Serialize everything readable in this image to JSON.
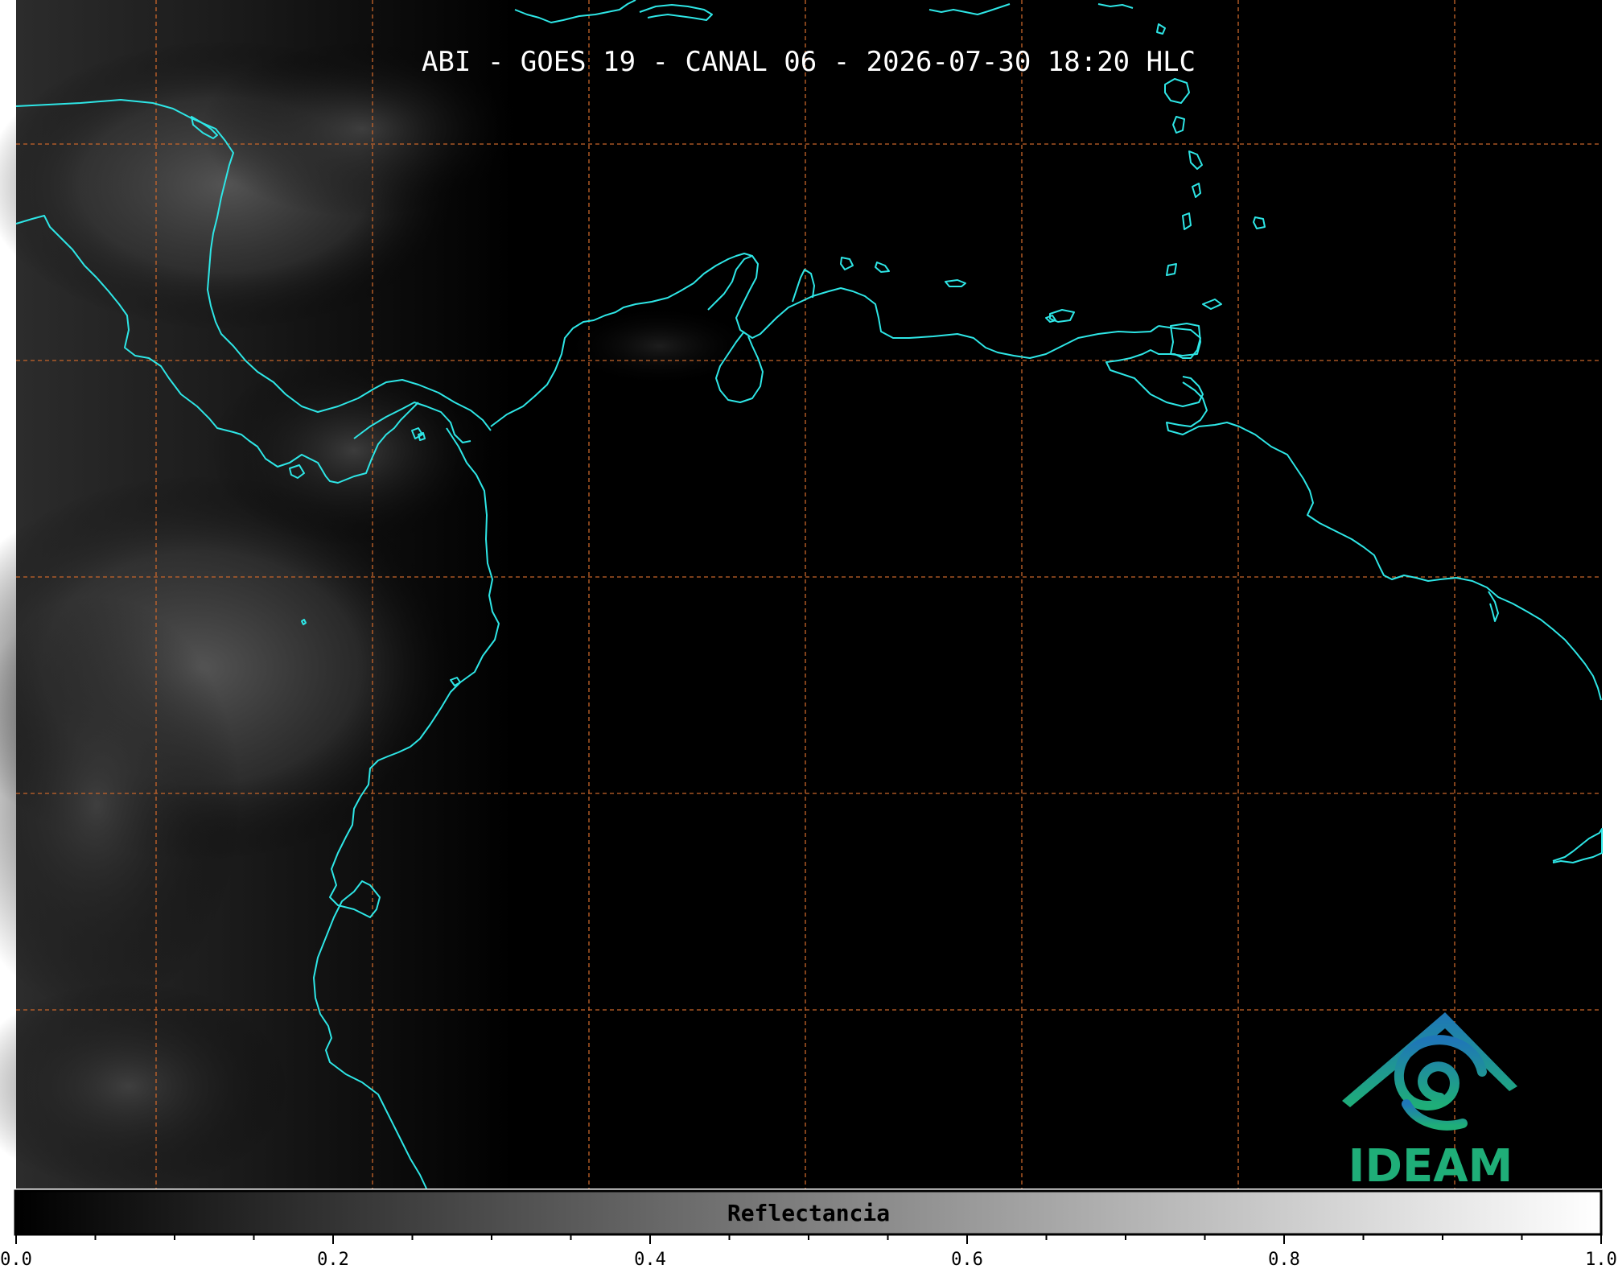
{
  "title": "ABI - GOES 19 - CANAL 06 - 2026-07-30 18:20 HLC",
  "colorbar": {
    "label": "Reflectancia",
    "range": [
      0.0,
      1.0
    ],
    "ticks": [
      "0.0",
      "0.2",
      "0.4",
      "0.6",
      "0.8",
      "1.0"
    ],
    "colormap": "grayscale"
  },
  "logo": {
    "text": "IDEAM"
  },
  "colors": {
    "background": "#000000",
    "coastline": "#2ee6e6",
    "gridline": "#c8652a",
    "logo_blue": "#1f76b8",
    "logo_green": "#1fae78"
  },
  "gridlines": {
    "style": "dashed",
    "visible": true
  }
}
